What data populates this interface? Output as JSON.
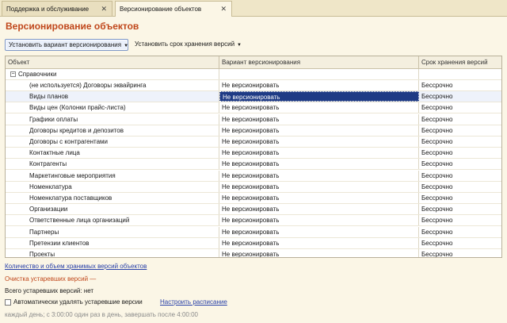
{
  "tabs": [
    {
      "label": "Поддержка и обслуживание",
      "close": "✕"
    },
    {
      "label": "Версионирование объектов",
      "close": "✕"
    }
  ],
  "page_title": "Версионирование объектов",
  "toolbar": {
    "set_variant_label": "Установить вариант версионирования",
    "set_period_label": "Установить срок хранения версий"
  },
  "table": {
    "columns": [
      "Объект",
      "Вариант версионирования",
      "Срок хранения версий"
    ],
    "group": {
      "toggle": "−",
      "label": "Справочники"
    },
    "rows": [
      {
        "object": "(не используется) Договоры эквайринга",
        "variant": "Не версионировать",
        "period": "Бессрочно"
      },
      {
        "object": "Виды планов",
        "variant": "Не версионировать",
        "period": "Бессрочно"
      },
      {
        "object": "Виды цен (Колонки прайс-листа)",
        "variant": "Не версионировать",
        "period": "Бессрочно"
      },
      {
        "object": "Графики оплаты",
        "variant": "Не версионировать",
        "period": "Бессрочно"
      },
      {
        "object": "Договоры кредитов и депозитов",
        "variant": "Не версионировать",
        "period": "Бессрочно"
      },
      {
        "object": "Договоры с контрагентами",
        "variant": "Не версионировать",
        "period": "Бессрочно"
      },
      {
        "object": "Контактные лица",
        "variant": "Не версионировать",
        "period": "Бессрочно"
      },
      {
        "object": "Контрагенты",
        "variant": "Не версионировать",
        "period": "Бессрочно"
      },
      {
        "object": "Маркетинговые мероприятия",
        "variant": "Не версионировать",
        "period": "Бессрочно"
      },
      {
        "object": "Номенклатура",
        "variant": "Не версионировать",
        "period": "Бессрочно"
      },
      {
        "object": "Номенклатура поставщиков",
        "variant": "Не версионировать",
        "period": "Бессрочно"
      },
      {
        "object": "Организации",
        "variant": "Не версионировать",
        "period": "Бессрочно"
      },
      {
        "object": "Ответственные лица организаций",
        "variant": "Не версионировать",
        "period": "Бессрочно"
      },
      {
        "object": "Партнеры",
        "variant": "Не версионировать",
        "period": "Бессрочно"
      },
      {
        "object": "Претензии клиентов",
        "variant": "Не версионировать",
        "period": "Бессрочно"
      },
      {
        "object": "Проекты",
        "variant": "Не версионировать",
        "period": "Бессрочно"
      }
    ],
    "selected_row": "Виды планов"
  },
  "bottom": {
    "stats_link": "Количество и объем хранимых версий объектов",
    "cleanup_title": "Очистка устаревших версий —",
    "obsolete_count": "Всего устаревших версий: нет",
    "auto_delete_label": "Автоматически удалять устаревшие версии",
    "auto_delete_checked": false,
    "schedule_link": "Настроить расписание",
    "schedule_text": "каждый день; с 3:00:00 один раз в день, завершать после 4:00:00"
  }
}
